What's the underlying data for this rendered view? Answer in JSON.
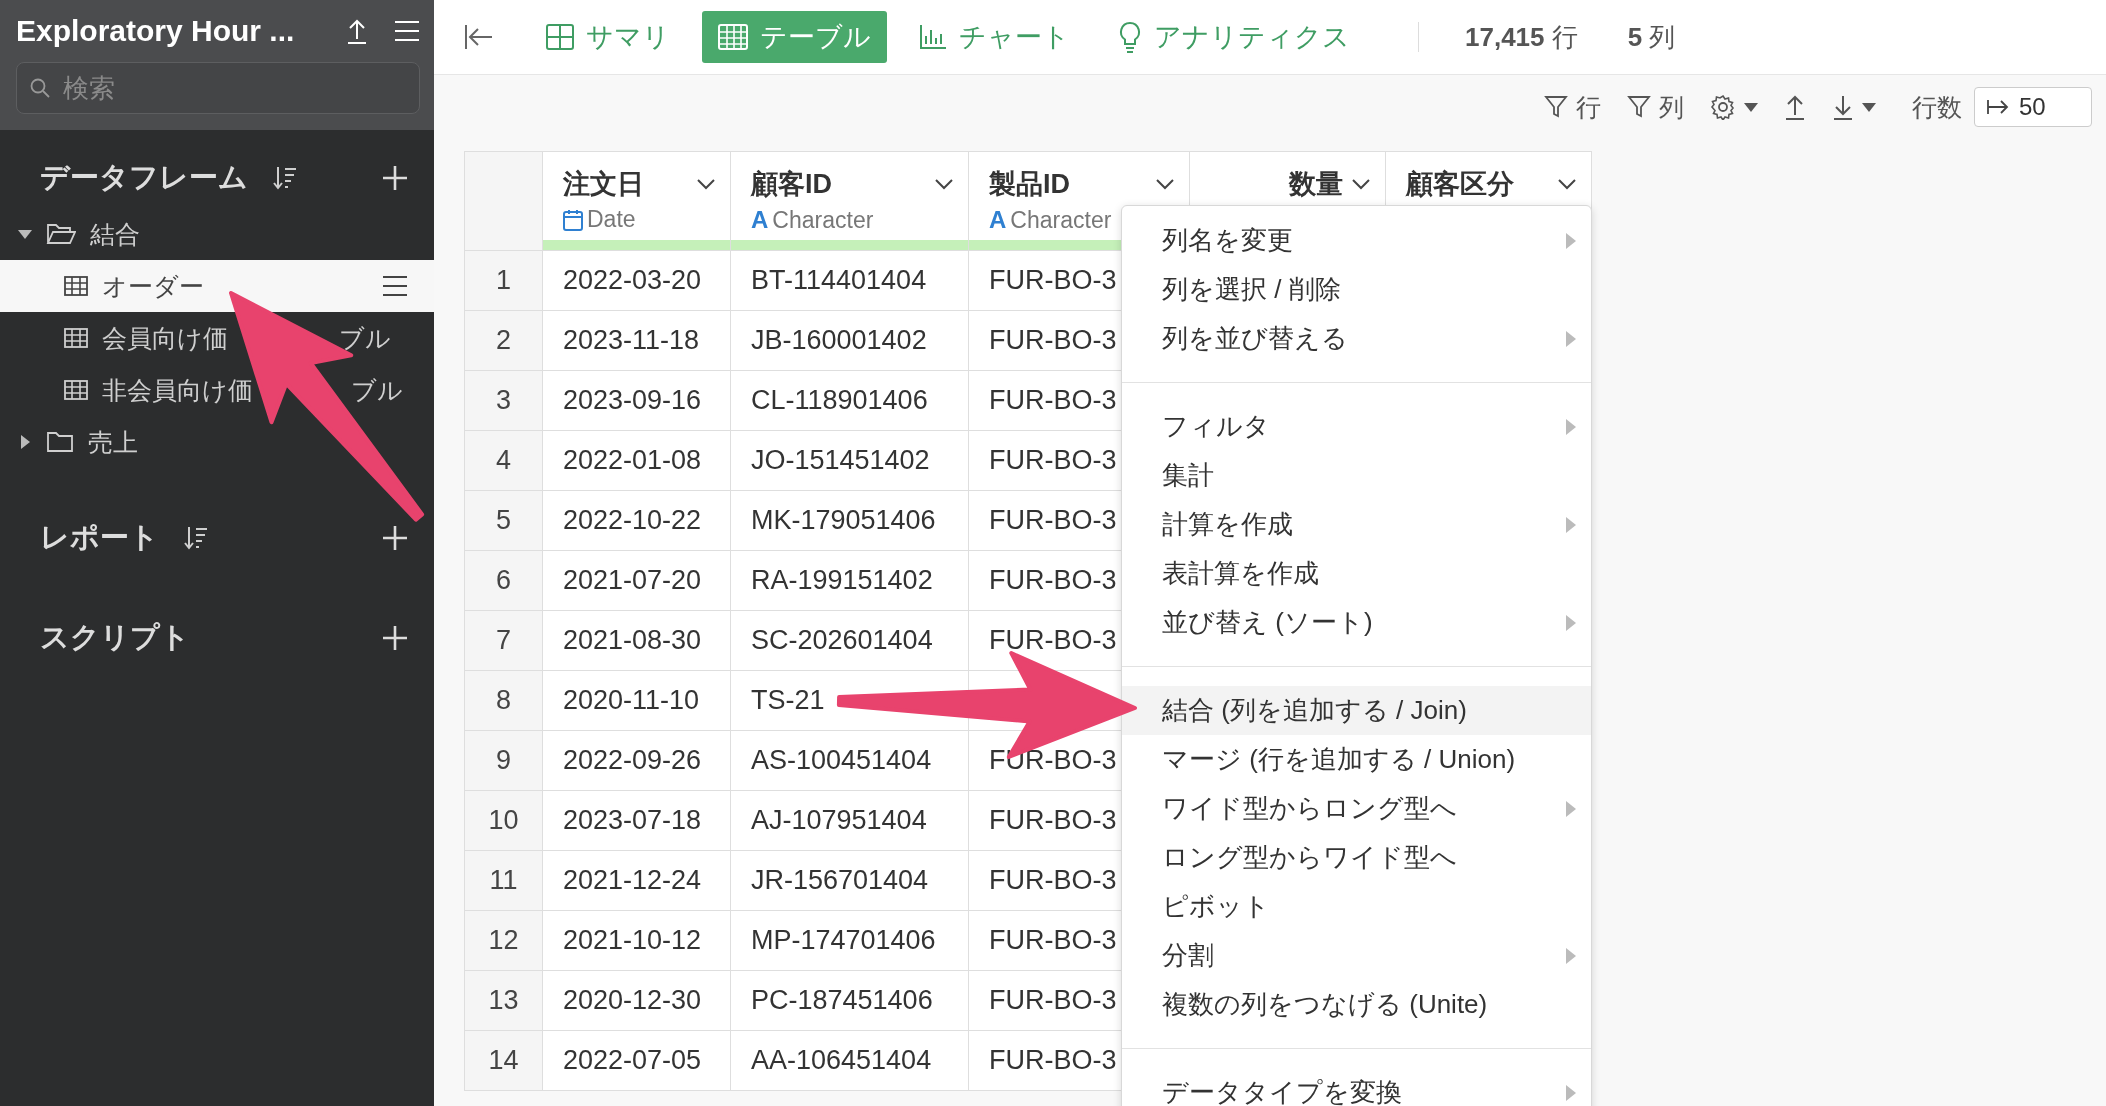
{
  "sidebar": {
    "title": "Exploratory Hour ...",
    "search": {
      "placeholder": "検索"
    },
    "sections": [
      {
        "title": "データフレーム",
        "sortable": true,
        "items": [
          {
            "label": "結合",
            "kind": "folder",
            "expanded": true,
            "children": [
              {
                "label": "オーダー",
                "kind": "table",
                "selected": true
              },
              {
                "label_parts": [
                  "会員向け価",
                  "ブル"
                ],
                "kind": "table",
                "selected": false
              },
              {
                "label_parts": [
                  "非会員向け価",
                  "ブル"
                ],
                "kind": "table",
                "selected": false
              }
            ]
          },
          {
            "label": "売上",
            "kind": "folder",
            "expanded": false
          }
        ]
      },
      {
        "title": "レポート",
        "sortable": true
      },
      {
        "title": "スクリプト",
        "sortable": false
      }
    ]
  },
  "tabs": [
    {
      "label": "サマリ",
      "kind": "summary",
      "selected": false
    },
    {
      "label": "テーブル",
      "kind": "table",
      "selected": true
    },
    {
      "label": "チャート",
      "kind": "chart",
      "selected": false
    },
    {
      "label": "アナリティクス",
      "kind": "analytics",
      "selected": false
    }
  ],
  "counts": [
    "**17,415** 行",
    "**5** 列"
  ],
  "actions": [
    {
      "kind": "filter",
      "label": "行",
      "dropdown": false
    },
    {
      "kind": "filter",
      "label": "列",
      "dropdown": false
    },
    {
      "kind": "settings",
      "dropdown": true
    },
    {
      "kind": "upload",
      "dropdown": false
    },
    {
      "kind": "download",
      "dropdown": true
    }
  ],
  "row_limit": {
    "label": "行数",
    "value": "50"
  },
  "table": {
    "columns": [
      {
        "name": "注文日",
        "right_aligned": false,
        "type": {
          "kind": "date",
          "label": "Date"
        }
      },
      {
        "name": "顧客ID",
        "right_aligned": false,
        "type": {
          "kind": "character",
          "mark": "A",
          "label": "Character"
        }
      },
      {
        "name": "製品ID",
        "right_aligned": false,
        "type": {
          "kind": "character",
          "mark": "A",
          "label": "Character"
        }
      },
      {
        "name": "数量",
        "right_aligned": true
      },
      {
        "name": "顧客区分",
        "right_aligned": false
      }
    ],
    "rows": [
      {
        "num": "1",
        "cells": [
          "2022-03-20",
          "BT-114401404",
          "FUR-BO-3"
        ]
      },
      {
        "num": "2",
        "cells": [
          "2023-11-18",
          "JB-160001402",
          "FUR-BO-3"
        ]
      },
      {
        "num": "3",
        "cells": [
          "2023-09-16",
          "CL-118901406",
          "FUR-BO-3"
        ]
      },
      {
        "num": "4",
        "cells": [
          "2022-01-08",
          "JO-151451402",
          "FUR-BO-3"
        ]
      },
      {
        "num": "5",
        "cells": [
          "2022-10-22",
          "MK-179051406",
          "FUR-BO-3"
        ]
      },
      {
        "num": "6",
        "cells": [
          "2021-07-20",
          "RA-199151402",
          "FUR-BO-3"
        ]
      },
      {
        "num": "7",
        "cells": [
          "2021-08-30",
          "SC-202601404",
          "FUR-BO-3"
        ]
      },
      {
        "num": "8",
        "cells": [
          "2020-11-10",
          "TS-21"
        ]
      },
      {
        "num": "9",
        "cells": [
          "2022-09-26",
          "AS-100451404",
          "FUR-BO-3"
        ]
      },
      {
        "num": "10",
        "cells": [
          "2023-07-18",
          "AJ-107951404",
          "FUR-BO-3"
        ]
      },
      {
        "num": "11",
        "cells": [
          "2021-12-24",
          "JR-156701404",
          "FUR-BO-3"
        ]
      },
      {
        "num": "12",
        "cells": [
          "2021-10-12",
          "MP-174701406",
          "FUR-BO-3"
        ]
      },
      {
        "num": "13",
        "cells": [
          "2020-12-30",
          "PC-187451406",
          "FUR-BO-3"
        ]
      },
      {
        "num": "14",
        "cells": [
          "2022-07-05",
          "AA-106451404",
          "FUR-BO-3"
        ]
      }
    ]
  },
  "context_menu": {
    "groups": [
      [
        {
          "label": "列名を変更",
          "submenu": true,
          "highlighted": false
        },
        {
          "label": "列を選択 / 削除",
          "submenu": false,
          "highlighted": false
        },
        {
          "label": "列を並び替える",
          "submenu": true,
          "highlighted": false
        }
      ],
      [
        {
          "label": "フィルタ",
          "submenu": true,
          "highlighted": false
        },
        {
          "label": "集計",
          "submenu": false,
          "highlighted": false
        },
        {
          "label": "計算を作成",
          "submenu": true,
          "highlighted": false
        },
        {
          "label": "表計算を作成",
          "submenu": false,
          "highlighted": false
        },
        {
          "label": "並び替え (ソート)",
          "submenu": true,
          "highlighted": false
        }
      ],
      [
        {
          "label": "結合 (列を追加する / Join)",
          "submenu": false,
          "highlighted": true
        },
        {
          "label": "マージ (行を追加する / Union)",
          "submenu": false,
          "highlighted": false
        },
        {
          "label": "ワイド型からロング型へ",
          "submenu": true,
          "highlighted": false
        },
        {
          "label": "ロング型からワイド型へ",
          "submenu": false,
          "highlighted": false
        },
        {
          "label": "ピボット",
          "submenu": false,
          "highlighted": false
        },
        {
          "label": "分割",
          "submenu": true,
          "highlighted": false
        },
        {
          "label": "複数の列をつなげる (Unite)",
          "submenu": false,
          "highlighted": false
        }
      ],
      [
        {
          "label": "データタイプを変換",
          "submenu": true,
          "highlighted": false
        }
      ]
    ]
  },
  "annotations": [
    {
      "kind": "arrow"
    },
    {
      "kind": "arrow"
    }
  ]
}
